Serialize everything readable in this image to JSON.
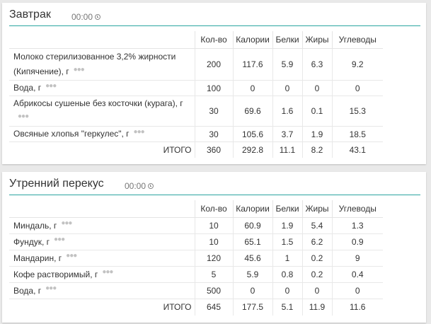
{
  "columns": {
    "qty": "Кол-во",
    "cal": "Калории",
    "prot": "Белки",
    "fat": "Жиры",
    "carb": "Углеводы"
  },
  "total_label": "ИТОГО",
  "meals": [
    {
      "title": "Завтрак",
      "time": "00:00",
      "rows": [
        {
          "name": "Молоко стерилизованное 3,2% жирности (Кипячение), г",
          "qty": "200",
          "cal": "117.6",
          "prot": "5.9",
          "fat": "6.3",
          "carb": "9.2"
        },
        {
          "name": "Вода, г",
          "qty": "100",
          "cal": "0",
          "prot": "0",
          "fat": "0",
          "carb": "0"
        },
        {
          "name": "Абрикосы сушеные без косточки (курага), г",
          "qty": "30",
          "cal": "69.6",
          "prot": "1.6",
          "fat": "0.1",
          "carb": "15.3"
        },
        {
          "name": "Овсяные хлопья \"геркулес\", г",
          "qty": "30",
          "cal": "105.6",
          "prot": "3.7",
          "fat": "1.9",
          "carb": "18.5"
        }
      ],
      "total": {
        "qty": "360",
        "cal": "292.8",
        "prot": "11.1",
        "fat": "8.2",
        "carb": "43.1"
      }
    },
    {
      "title": "Утренний перекус",
      "time": "00:00",
      "rows": [
        {
          "name": "Миндаль, г",
          "qty": "10",
          "cal": "60.9",
          "prot": "1.9",
          "fat": "5.4",
          "carb": "1.3"
        },
        {
          "name": "Фундук, г",
          "qty": "10",
          "cal": "65.1",
          "prot": "1.5",
          "fat": "6.2",
          "carb": "0.9"
        },
        {
          "name": "Мандарин, г",
          "qty": "120",
          "cal": "45.6",
          "prot": "1",
          "fat": "0.2",
          "carb": "9"
        },
        {
          "name": "Кофе растворимый, г",
          "qty": "5",
          "cal": "5.9",
          "prot": "0.8",
          "fat": "0.2",
          "carb": "0.4"
        },
        {
          "name": "Вода, г",
          "qty": "500",
          "cal": "0",
          "prot": "0",
          "fat": "0",
          "carb": "0"
        }
      ],
      "total": {
        "qty": "645",
        "cal": "177.5",
        "prot": "5.1",
        "fat": "11.9",
        "carb": "11.6"
      }
    }
  ]
}
